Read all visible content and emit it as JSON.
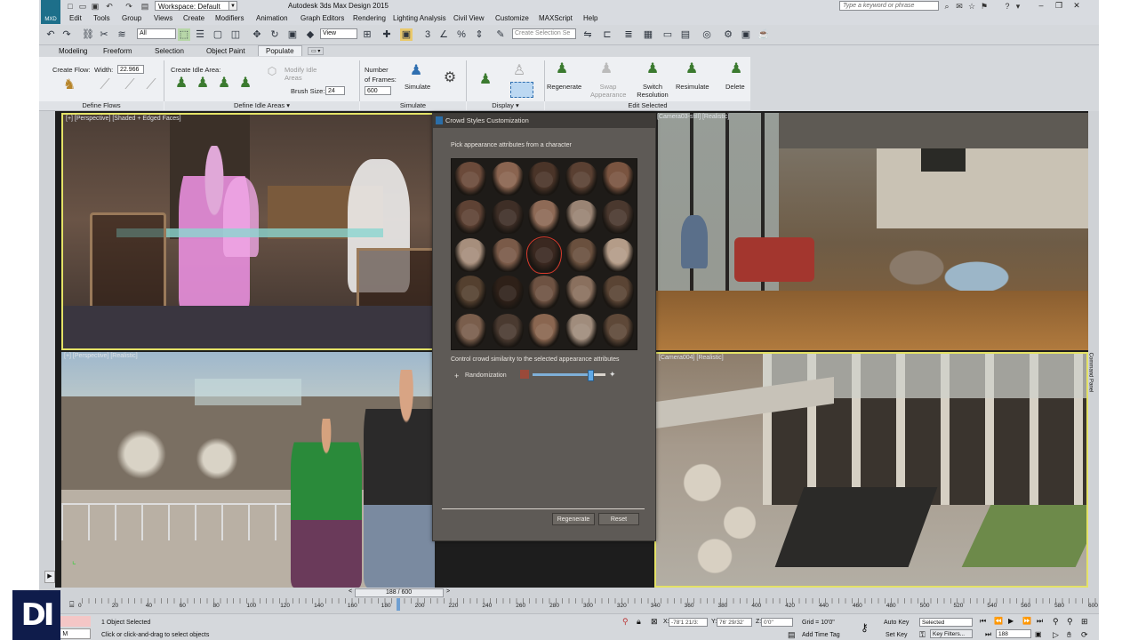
{
  "window": {
    "app_title": "Autodesk 3ds Max Design 2015",
    "workspace": "Workspace: Default",
    "search_placeholder": "Type a keyword or phrase",
    "app_badge": "MXD"
  },
  "menu": [
    "Edit",
    "Tools",
    "Group",
    "Views",
    "Create",
    "Modifiers",
    "Animation",
    "Graph Editors",
    "Rendering",
    "Lighting Analysis",
    "Civil View",
    "Customize",
    "MAXScript",
    "Help"
  ],
  "toolbar": {
    "filter_value": "All",
    "refcoord_value": "View",
    "named_selection_placeholder": "Create Selection Se",
    "snap_label": "3"
  },
  "ribbon": {
    "tabs": [
      "Modeling",
      "Freeform",
      "Selection",
      "Object Paint",
      "Populate"
    ],
    "active_tab": "Populate",
    "create_flow_label": "Create Flow:",
    "width_label": "Width:",
    "width_value": "22.966",
    "create_idle_label": "Create Idle Area:",
    "modify_idle_label": "Modify Idle Areas",
    "brush_size_label": "Brush Size:",
    "brush_size_value": "24",
    "number_label": "Number",
    "of_frames_label": "of Frames:",
    "frames_value": "600",
    "simulate_label": "Simulate",
    "regenerate_label": "Regenerate",
    "swap_appearance_label": "Swap Appearance",
    "switch_resolution_label": "Switch Resolution",
    "resimulate_label": "Resimulate",
    "delete_label": "Delete",
    "footer_define_flows": "Define Flows",
    "footer_define_idle": "Define Idle Areas ▾",
    "footer_simulate": "Simulate",
    "footer_display": "Display ▾",
    "footer_edit_selected": "Edit Selected"
  },
  "viewports": {
    "tl": "[+] [Perspective] [Shaded + Edged Faces]",
    "tr": "[Camera03-still] [Realistic]",
    "bl": "[+] [Perspective] [Realistic]",
    "br": "[Camera004] [Realistic]"
  },
  "dialog": {
    "title": "Crowd Styles Customization",
    "pick_text": "Pick appearance attributes from a character",
    "control_text": "Control crowd similarity to the selected appearance attributes",
    "randomization_label": "Randomization",
    "randomization_value": 0.78,
    "regenerate_button": "Regenerate",
    "reset_button": "Reset",
    "selected_face": "row 3, col 3",
    "face_colors": [
      [
        "#6b4a3a",
        "#8a6450",
        "#4a3428",
        "#5a4032",
        "#7a5440"
      ],
      [
        "#5e4234",
        "#3e2e26",
        "#8e6a56",
        "#9a8474",
        "#4a382e"
      ],
      [
        "#a68e7c",
        "#7a5a48",
        "#3a2820",
        "#6a503e",
        "#b49c88"
      ],
      [
        "#54402f",
        "#2e2018",
        "#6e5242",
        "#8a705e",
        "#5a4434"
      ],
      [
        "#7a5e4c",
        "#4a3a30",
        "#8a6650",
        "#a08c7c",
        "#5e4838"
      ]
    ]
  },
  "timeline": {
    "frame_readout": "188 / 600",
    "current_frame": 188,
    "total_frames": 600,
    "ticks": [
      "0",
      "20",
      "40",
      "60",
      "80",
      "100",
      "120",
      "140",
      "160",
      "180",
      "200",
      "220",
      "240",
      "260",
      "280",
      "300",
      "320",
      "340",
      "360",
      "380",
      "400",
      "420",
      "440",
      "460",
      "480",
      "500",
      "520",
      "540",
      "560",
      "580",
      "600"
    ]
  },
  "status": {
    "welcome": "ome to M",
    "objects_selected": "1 Object Selected",
    "prompt": "Click or click-and-drag to select objects",
    "x_label": "X:",
    "x_value": "-78'1 21/3:",
    "y_label": "Y:",
    "y_value": "76' 29/32'",
    "z_label": "Z:",
    "z_value": "0'0\"",
    "grid": "Grid = 10'0\"",
    "add_time_tag": "Add Time Tag",
    "auto_key": "Auto Key",
    "set_key": "Set Key",
    "selected_dropdown": "Selected",
    "key_filters": "Key Filters...",
    "frame_field": "188",
    "command_panel": "Command Panel"
  },
  "logo_text": "DI"
}
